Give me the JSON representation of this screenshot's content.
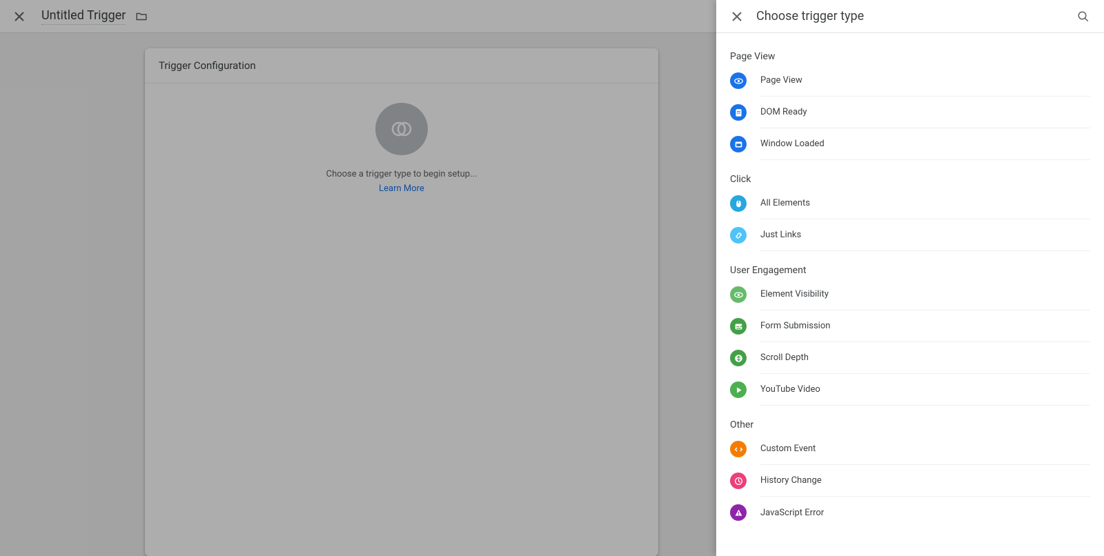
{
  "editor": {
    "title": "Untitled Trigger",
    "card_title": "Trigger Configuration",
    "hint": "Choose a trigger type to begin setup...",
    "learn_more": "Learn More"
  },
  "panel": {
    "title": "Choose trigger type"
  },
  "groups": [
    {
      "label": "Page View",
      "items": [
        {
          "name": "Page View",
          "icon": "eye",
          "color": "c-blue"
        },
        {
          "name": "DOM Ready",
          "icon": "doc",
          "color": "c-blue2"
        },
        {
          "name": "Window Loaded",
          "icon": "window",
          "color": "c-blue2"
        }
      ]
    },
    {
      "label": "Click",
      "items": [
        {
          "name": "All Elements",
          "icon": "mouse",
          "color": "c-cyan"
        },
        {
          "name": "Just Links",
          "icon": "link",
          "color": "c-cyan2"
        }
      ]
    },
    {
      "label": "User Engagement",
      "items": [
        {
          "name": "Element Visibility",
          "icon": "eye",
          "color": "c-green"
        },
        {
          "name": "Form Submission",
          "icon": "form",
          "color": "c-green2"
        },
        {
          "name": "Scroll Depth",
          "icon": "scroll",
          "color": "c-green2"
        },
        {
          "name": "YouTube Video",
          "icon": "play",
          "color": "c-green3"
        }
      ]
    },
    {
      "label": "Other",
      "items": [
        {
          "name": "Custom Event",
          "icon": "code",
          "color": "c-orange"
        },
        {
          "name": "History Change",
          "icon": "history",
          "color": "c-pink"
        },
        {
          "name": "JavaScript Error",
          "icon": "warn",
          "color": "c-purple"
        }
      ]
    }
  ]
}
